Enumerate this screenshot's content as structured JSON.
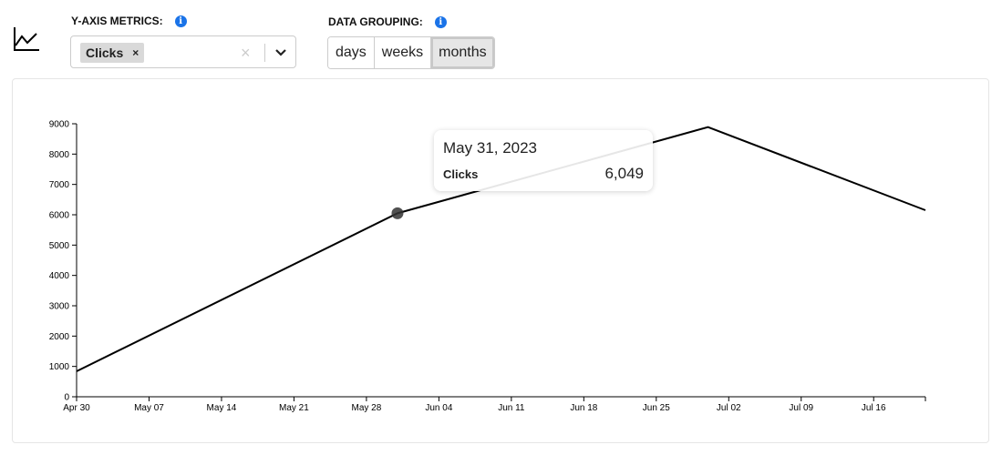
{
  "controls": {
    "chart_type_icon": "line-chart-icon",
    "y_axis_label": "Y-AXIS METRICS:",
    "selected_metrics": [
      {
        "label": "Clicks",
        "remove": "×"
      }
    ],
    "clear_glyph": "×",
    "grouping_label": "DATA GROUPING:",
    "grouping_options": [
      {
        "label": "days",
        "active": false
      },
      {
        "label": "weeks",
        "active": false
      },
      {
        "label": "months",
        "active": true
      }
    ],
    "info_glyph": "i",
    "accent_color": "#1a73e8"
  },
  "tooltip": {
    "date": "May 31, 2023",
    "metric": "Clicks",
    "value": "6,049"
  },
  "chart_data": {
    "type": "line",
    "title": "",
    "xlabel": "",
    "ylabel": "",
    "series": [
      {
        "name": "Clicks",
        "color": "#000000",
        "points": [
          {
            "date": "2023-04-30",
            "value": 840
          },
          {
            "date": "2023-05-31",
            "value": 6049
          },
          {
            "date": "2023-06-30",
            "value": 8890
          },
          {
            "date": "2023-07-21",
            "value": 6150
          }
        ]
      }
    ],
    "highlighted_point": {
      "date": "2023-05-31",
      "value": 6049
    },
    "xlim": [
      "2023-04-30",
      "2023-07-21"
    ],
    "ylim": [
      0,
      9000
    ],
    "x_ticks": [
      "Apr 30",
      "May 07",
      "May 14",
      "May 21",
      "May 28",
      "Jun 04",
      "Jun 11",
      "Jun 18",
      "Jun 25",
      "Jul 02",
      "Jul 09",
      "Jul 16"
    ],
    "x_tick_dates": [
      "2023-04-30",
      "2023-05-07",
      "2023-05-14",
      "2023-05-21",
      "2023-05-28",
      "2023-06-04",
      "2023-06-11",
      "2023-06-18",
      "2023-06-25",
      "2023-07-02",
      "2023-07-09",
      "2023-07-16"
    ],
    "y_ticks": [
      0,
      1000,
      2000,
      3000,
      4000,
      5000,
      6000,
      7000,
      8000,
      9000
    ],
    "grid": false,
    "legend": "none"
  }
}
